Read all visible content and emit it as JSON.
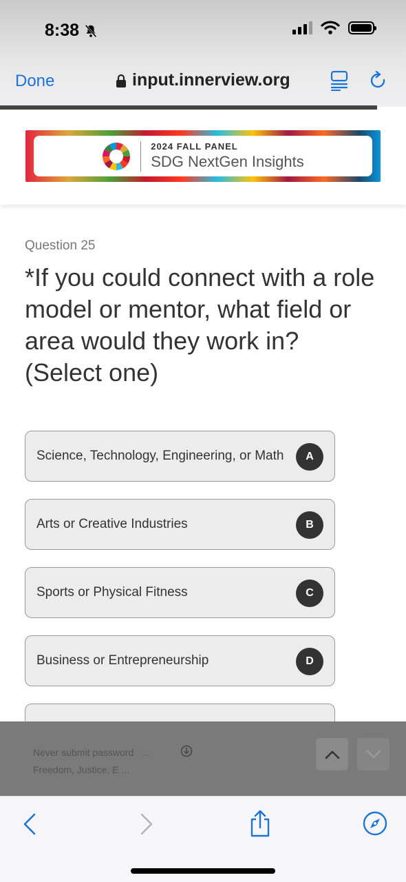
{
  "status_bar": {
    "time": "8:38",
    "icons": [
      "bell-slash-icon",
      "cellular-signal-icon",
      "wifi-icon",
      "battery-icon"
    ]
  },
  "browser": {
    "done_label": "Done",
    "url": "input.innerview.org",
    "icons": [
      "lock-icon",
      "reader-mode-icon",
      "reload-icon"
    ],
    "accent_color": "#1a73d9"
  },
  "banner": {
    "line1": "2024 FALL PANEL",
    "line2": "SDG NextGen Insights"
  },
  "question": {
    "number": "Question 25",
    "text": "*If you could connect with a role model or mentor, what field or area would they work in? (Select one)"
  },
  "options": [
    {
      "label": "Science, Technology, Engineering, or Math",
      "key": "A"
    },
    {
      "label": "Arts or Creative Industries",
      "key": "B"
    },
    {
      "label": "Sports or Physical Fitness",
      "key": "C"
    },
    {
      "label": "Business or Entrepreneurship",
      "key": "D"
    }
  ],
  "autofill": {
    "line1_left": "Never submit password",
    "line1_right": "...",
    "line2": "Freedom, Justice, E ..."
  },
  "toolbar": {
    "icons": [
      "back-icon",
      "forward-icon",
      "share-icon",
      "compass-icon"
    ]
  }
}
